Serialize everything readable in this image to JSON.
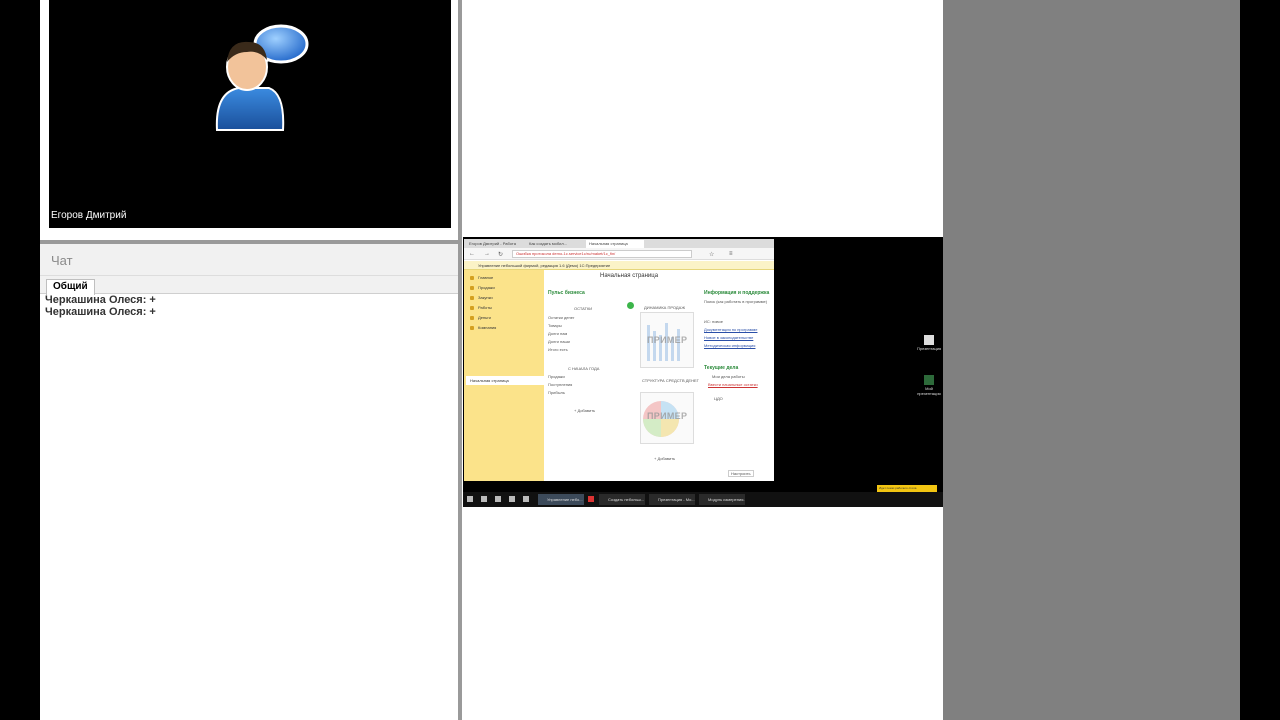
{
  "presenter": {
    "name": "Егоров Дмитрий"
  },
  "chat": {
    "title": "Чат",
    "tabs": [
      "Общий"
    ],
    "messages": [
      "Черкашина Олеся: +",
      "Черкашина Олеся: +"
    ]
  },
  "screen": {
    "browser_tabs": [
      "Егоров Дмитрий - Работа",
      "Как создать мобил...",
      "Начальная страница"
    ],
    "url": "Ошибка протокола   demo-1c.service1c/ru/maket/1c_fin/",
    "app_title": "Управление небольшой фирмой, редакция 1.6 (Демо)   1С:Предприятие",
    "sidebar_items": [
      "Главное",
      "Продажи",
      "Закупки",
      "Работы",
      "Деньги",
      "Компания"
    ],
    "sidebar_active": "Начальная страница",
    "page_title": "Начальная страница",
    "pulse": {
      "title": "Пульс бизнеса",
      "remains_title": "ОСТАТКИ",
      "remains_items": [
        "Остатки денег",
        "Товары",
        "Долги нам",
        "Долги наши",
        "Итого есть"
      ],
      "year_title": "С НАЧАЛА ГОДА",
      "year_items": [
        "Продажи",
        "Поступления",
        "Прибыль"
      ],
      "add_label": "+ Добавить"
    },
    "charts": {
      "sales_title": "ДИНАМИКА ПРОДАЖ",
      "money_title": "СТРУКТУРА СРЕДСТВ ДЕНЕГ",
      "watermark": "ПРИМЕР",
      "add_label": "+ Добавить"
    },
    "info": {
      "title": "Информация и поддержка",
      "search_label": "Поиск (как работать в программе)",
      "links": [
        "Документация по программе",
        "Новое в законодательстве",
        "Методическая информация"
      ],
      "news_label": "ИС: новое"
    },
    "tasks": {
      "title": "Текущие дела",
      "items": [
        "Мои дела работы",
        "Ввести начальные остатки",
        "ЦДО"
      ]
    },
    "configure_label": "Настроить",
    "taskbar": [
      "Управление небо...",
      "Создать небольш...",
      "Презентация - Мо...",
      "Модуль измерения..."
    ],
    "desktop_icons": [
      "Презентация",
      "Мой презентация"
    ],
    "notification": {
      "text": "Идет показ рабочего стола",
      "button": "Остановить"
    },
    "colors": {
      "accent": "#2a8a3a",
      "sidebar": "#fbe38a",
      "link": "#2a4fa8"
    }
  }
}
